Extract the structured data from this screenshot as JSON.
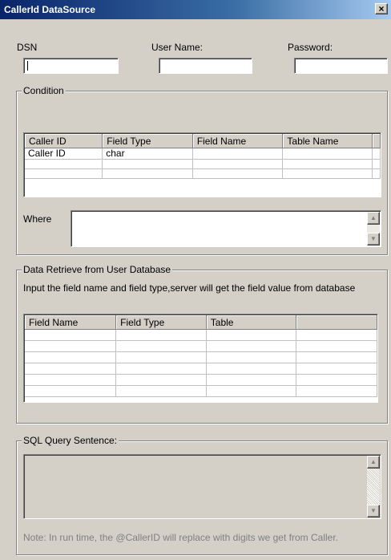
{
  "window": {
    "title": "CallerId DataSource",
    "close_label": "×"
  },
  "connection": {
    "dsn_label": "DSN",
    "username_label": "User Name:",
    "password_label": "Password:",
    "dsn_value": "",
    "username_value": "",
    "password_value": ""
  },
  "condition": {
    "title": "Condition",
    "columns": [
      "Caller ID",
      "Field Type",
      "Field Name",
      "Table Name"
    ],
    "rows": [
      [
        "Caller ID",
        "char",
        "",
        ""
      ],
      [
        "",
        "",
        "",
        ""
      ],
      [
        "",
        "",
        "",
        ""
      ]
    ],
    "where_label": "Where",
    "where_value": ""
  },
  "retrieve": {
    "title": "Data Retrieve from User Database",
    "description": "Input the field name and field type,server will get the field value from database",
    "columns": [
      "Field Name",
      "Field Type",
      "Table",
      ""
    ],
    "rows": [
      [
        "",
        "",
        "",
        ""
      ],
      [
        "",
        "",
        "",
        ""
      ],
      [
        "",
        "",
        "",
        ""
      ],
      [
        "",
        "",
        "",
        ""
      ],
      [
        "",
        "",
        "",
        ""
      ],
      [
        "",
        "",
        "",
        ""
      ]
    ]
  },
  "sql": {
    "title": "SQL Query Sentence:",
    "value": "",
    "note": "Note: In run time, the @CallerID will replace with digits we get from Caller."
  },
  "icons": {
    "scroll_up": "scroll-up-arrow-icon",
    "scroll_down": "scroll-down-arrow-icon"
  },
  "colors": {
    "titlebar_start": "#0a246a",
    "titlebar_end": "#a6caf0",
    "dialog_bg": "#d4d0c8"
  }
}
